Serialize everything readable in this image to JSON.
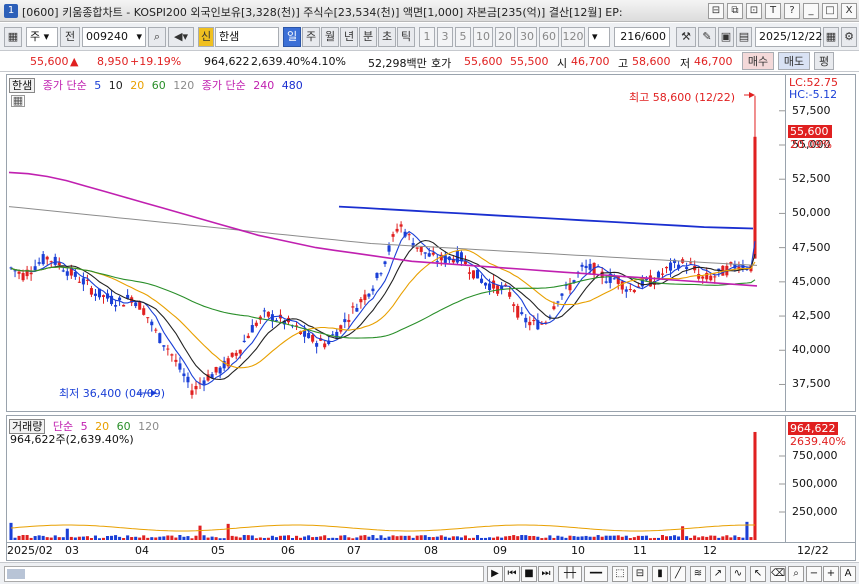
{
  "window": {
    "app_id": "1",
    "title": "[0600] 키움종합차트 - KOSPI200 외국인보유[3,328(천)] 주식수[23,534(천)] 액면[1,000] 자본금[235(억)] 결산[12월] EP:",
    "controls": [
      "⊟",
      "⧉",
      "⊡",
      "T",
      "?",
      "_",
      "□",
      "X"
    ]
  },
  "toolbar": {
    "period_unit": "주",
    "prev_label": "전",
    "stock_code": "009240",
    "new_badge": "신",
    "stock_name": "한샘",
    "tabs": [
      "일",
      "주",
      "월",
      "년",
      "분",
      "초",
      "틱"
    ],
    "active_tab": "일",
    "numbers": [
      "1",
      "3",
      "5",
      "10",
      "20",
      "30",
      "60",
      "120"
    ],
    "count": "216",
    "total": "/600",
    "date": "2025/12/22"
  },
  "infobar": {
    "price": "55,600",
    "change": "8,950",
    "change_pct": "+19.19%",
    "volume": "964,622",
    "volume_pct": "2,639.40%",
    "turnover_pct": "4.10%",
    "amount": "52,298백만",
    "ask_label": "호가",
    "ask1": "55,600",
    "ask2": "55,500",
    "open_label": "시",
    "open": "46,700",
    "high_label": "고",
    "high": "58,600",
    "low_label": "저",
    "low": "46,700",
    "buy_label": "매수",
    "sell_label": "매도",
    "eval_label": "평"
  },
  "price_legend": {
    "name": "한샘",
    "ma1_label": "종가 단순",
    "ma1_periods": [
      "5",
      "10",
      "20",
      "60",
      "120"
    ],
    "ma2_label": "종가 단순",
    "ma2_periods": [
      "240",
      "480"
    ],
    "lc": "LC:52.75",
    "hc": "HC:-5.12",
    "high_note": "최고 58,600 (12/22)",
    "low_note": "최저 36,400 (04/09)",
    "current_price_tag": "55,600",
    "current_pct_tag": "20.09%"
  },
  "volume_legend": {
    "label": "거래량",
    "ma_label": "단순",
    "ma_periods": [
      "5",
      "20",
      "60",
      "120"
    ],
    "current": "964,622주(2,639.40%)",
    "tag_value": "964,622",
    "tag_pct": "2639.40%"
  },
  "price_axis": [
    "57,500",
    "55,000",
    "52,500",
    "50,000",
    "47,500",
    "45,000",
    "42,500",
    "40,000",
    "37,500"
  ],
  "volume_axis": [
    "750,000",
    "500,000",
    "250,000"
  ],
  "date_axis": [
    "2025/02",
    "03",
    "04",
    "05",
    "06",
    "07",
    "08",
    "09",
    "10",
    "11",
    "12",
    "12/22"
  ],
  "colors": {
    "up": "#e02020",
    "down": "#1a3fd6",
    "ma5": "#1a3fd6",
    "ma10": "#222222",
    "ma20": "#e8a000",
    "ma60": "#2a8f2a",
    "ma120": "#8c8c8c",
    "ma240": "#c020b0",
    "ma480": "#1a2fd0"
  },
  "chart_data": {
    "type": "candlestick",
    "x_range": [
      "2025/02",
      "2025/12/22"
    ],
    "ylim": [
      36000,
      58800
    ],
    "last": {
      "date": "12/22",
      "open": 46700,
      "high": 58600,
      "low": 46700,
      "close": 55600,
      "volume": 964622
    },
    "high_point": {
      "date": "12/22",
      "value": 58600
    },
    "low_point": {
      "date": "04/09",
      "value": 36400
    },
    "close_series": [
      46000,
      45500,
      46200,
      46800,
      46300,
      45600,
      45000,
      44200,
      43800,
      43500,
      43900,
      42900,
      41200,
      40100,
      38500,
      37000,
      38000,
      38400,
      39200,
      40300,
      41800,
      42600,
      42300,
      41900,
      41200,
      40700,
      40500,
      41500,
      42700,
      43800,
      44900,
      47000,
      49300,
      48000,
      47200,
      46600,
      46700,
      46900,
      45800,
      45000,
      44600,
      44300,
      42400,
      41900,
      42000,
      43800,
      44600,
      45900,
      46000,
      45300,
      45200,
      44400,
      44900,
      45100,
      45800,
      46400,
      46200,
      45200,
      45400,
      45900,
      46300,
      46100,
      55600
    ],
    "ma240_approx": [
      53000,
      52900,
      52700,
      52400,
      52000,
      51600,
      51200,
      50800,
      50400,
      50000,
      49600,
      49200,
      48800,
      48400,
      48100,
      47800,
      47500,
      47300,
      47100,
      46900,
      46700,
      46500,
      46400,
      46300,
      46200,
      46100,
      46000,
      45900,
      45800,
      45700,
      45600,
      45500,
      45400,
      45300,
      45200,
      45100,
      45000,
      44900,
      44800,
      44700
    ],
    "ma480_approx": [
      50500,
      50400,
      50300,
      50200,
      50100,
      50000,
      49900,
      49800,
      49700,
      49600,
      49500,
      49400,
      49300,
      49200,
      49100,
      49000,
      48950,
      48900
    ],
    "volume_spike": 964622
  }
}
